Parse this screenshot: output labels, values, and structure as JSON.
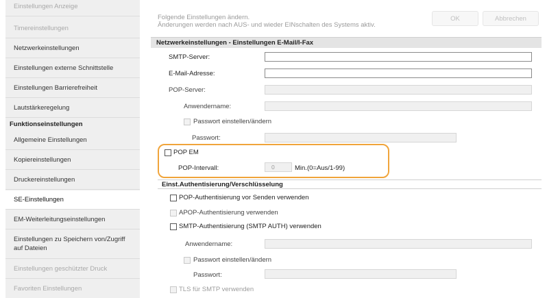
{
  "sidebar": {
    "items": [
      {
        "label": "Einstellungen Anzeige",
        "state": "dim"
      },
      {
        "label": "Timereinstellungen",
        "state": "dim"
      },
      {
        "label": "Netzwerkeinstellungen",
        "state": "normal"
      },
      {
        "label": "Einstellungen externe Schnittstelle",
        "state": "normal"
      },
      {
        "label": "Einstellungen Barrierefreiheit",
        "state": "normal"
      },
      {
        "label": "Lautstärkeregelung",
        "state": "normal"
      }
    ],
    "group_header": "Funktionseinstellungen",
    "group_items": [
      {
        "label": "Allgemeine Einstellungen",
        "state": "normal"
      },
      {
        "label": "Kopiereinstellungen",
        "state": "normal"
      },
      {
        "label": "Druckereinstellungen",
        "state": "normal"
      },
      {
        "label": "SE-Einstellungen",
        "state": "selected"
      },
      {
        "label": "EM-Weiterleitungseinstellungen",
        "state": "normal"
      },
      {
        "label": "Einstellungen zu Speichern von/Zugriff auf Dateien",
        "state": "normal"
      },
      {
        "label": "Einstellungen geschützter Druck",
        "state": "dim"
      },
      {
        "label": "Favoriten Einstellungen",
        "state": "dim"
      }
    ]
  },
  "top": {
    "note_line1": "Folgende Einstellungen ändern.",
    "note_line2": "Änderungen werden nach AUS- und wieder EINschalten des Systems aktiv.",
    "ok_label": "OK",
    "cancel_label": "Abbrechen"
  },
  "section_title": "Netzwerkeinstellungen - Einstellungen E-Mail/I-Fax",
  "form": {
    "smtp_server_label": "SMTP-Server:",
    "email_label": "E-Mail-Adresse:",
    "pop_server_label": "POP-Server:",
    "username_label": "Anwendername:",
    "set_password_label": "Passwort einstellen/ändern",
    "password_label": "Passwort:",
    "pop_em_label": "POP EM",
    "pop_interval_label": "POP-Intervall:",
    "pop_interval_value": "0",
    "pop_interval_unit": "Min.(0=Aus/1-99)"
  },
  "auth_section": {
    "title": "Einst.Authentisierung/Verschlüsselung",
    "pop_before_send": "POP-Authentisierung vor Senden verwenden",
    "apop": "APOP-Authentisierung verwenden",
    "smtp_auth": "SMTP-Authentisierung (SMTP AUTH) verwenden",
    "username_label": "Anwendername:",
    "set_password_label": "Passwort einstellen/ändern",
    "password_label": "Passwort:",
    "tls_smtp": "TLS für SMTP verwenden"
  },
  "colors": {
    "highlight": "#f0a43a",
    "sidebar_bg": "#efefef",
    "section_bar": "#e4e4e4"
  }
}
